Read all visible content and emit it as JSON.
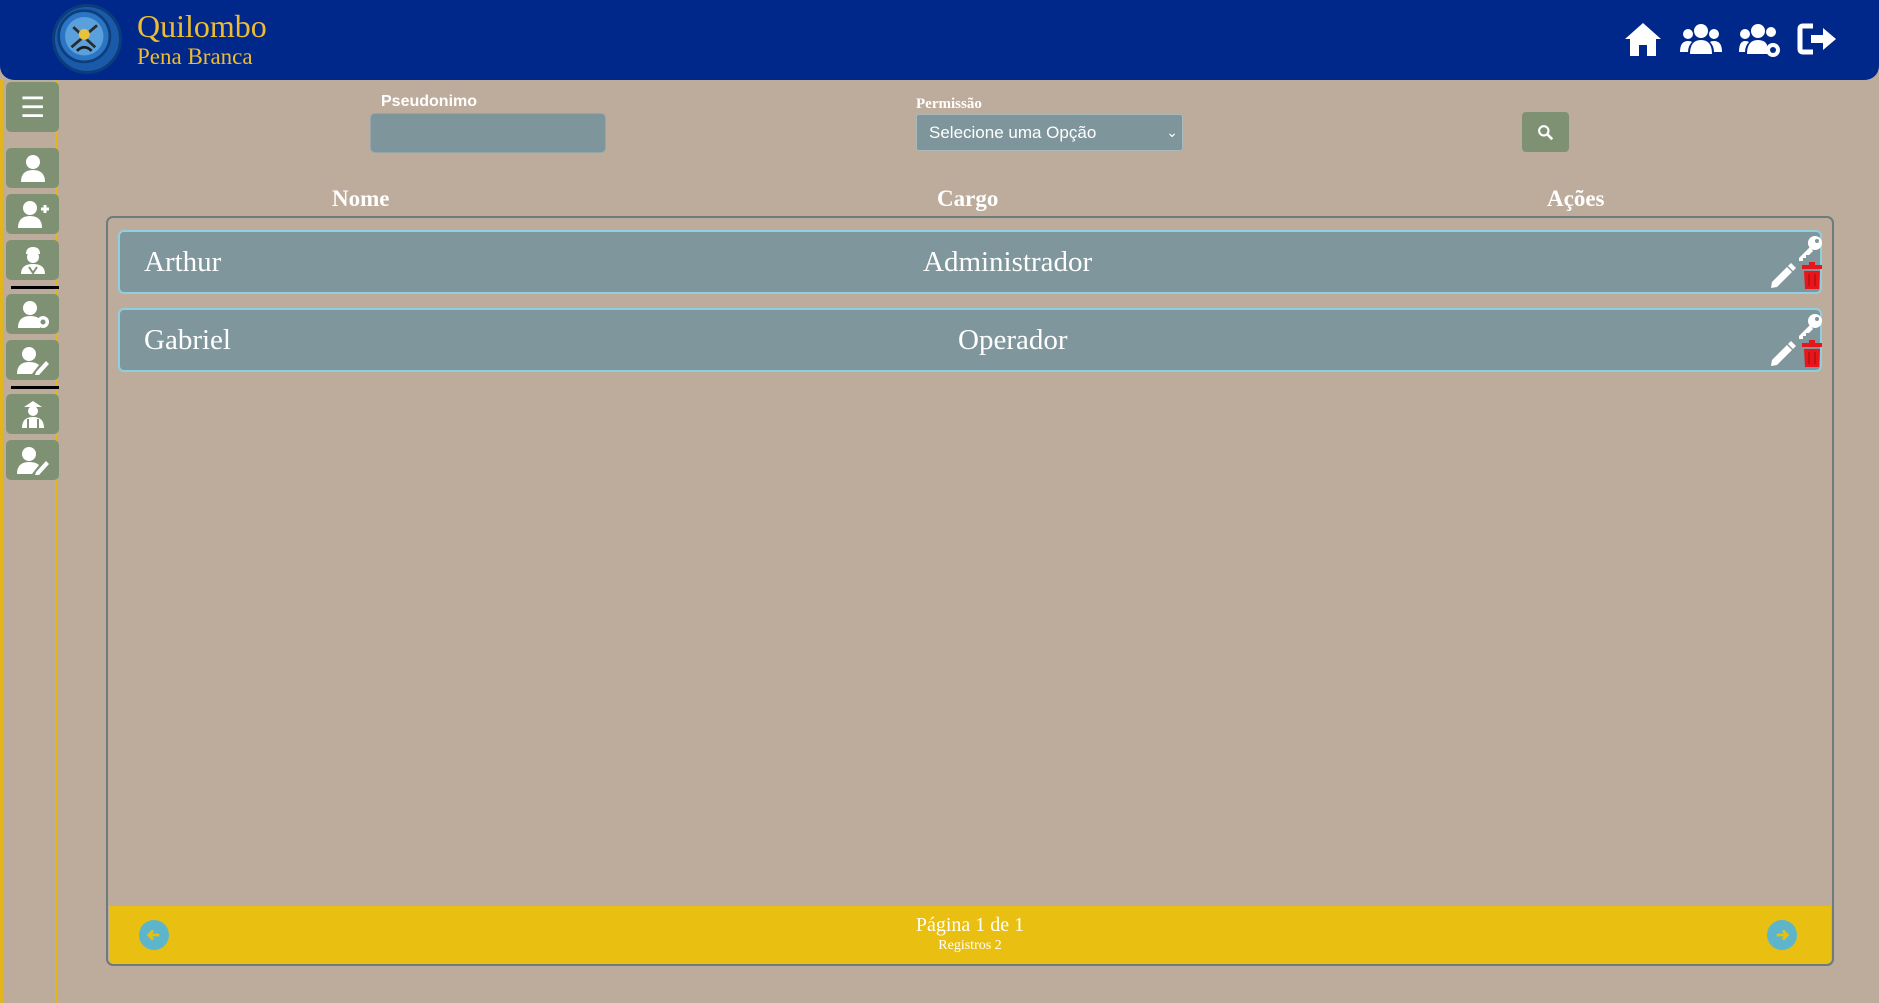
{
  "header": {
    "title": "Quilombo",
    "subtitle": "Pena Branca",
    "nav_icons": [
      "home-icon",
      "users-icon",
      "users-cog-icon",
      "sign-out-icon"
    ]
  },
  "sidebar": {
    "toggle": "☰",
    "items": [
      "user-icon",
      "user-plus-icon",
      "user-worker-icon",
      "user-cog-icon",
      "user-edit-icon",
      "capoeira-icon",
      "user-edit-icon"
    ]
  },
  "filters": {
    "pseudonimo_label": "Pseudonimo",
    "pseudonimo_value": "",
    "permissao_label": "Permissão",
    "permissao_selected": "Selecione uma Opção"
  },
  "table": {
    "headers": [
      "Nome",
      "Cargo",
      "Ações"
    ],
    "rows": [
      {
        "nome": "Arthur",
        "cargo": "Administrador"
      },
      {
        "nome": "Gabriel",
        "cargo": "Operador"
      }
    ]
  },
  "pagination": {
    "page_text": "Página 1 de 1",
    "records_text": "Registros 2"
  },
  "colors": {
    "header_bg": "#00288a",
    "brand": "#efbc2e",
    "page_bg": "#bdac9c",
    "sidebar_btn": "#7e9172",
    "row_bg": "#7e969c",
    "pager_bg": "#e9bf12",
    "delete": "#e8161b"
  }
}
